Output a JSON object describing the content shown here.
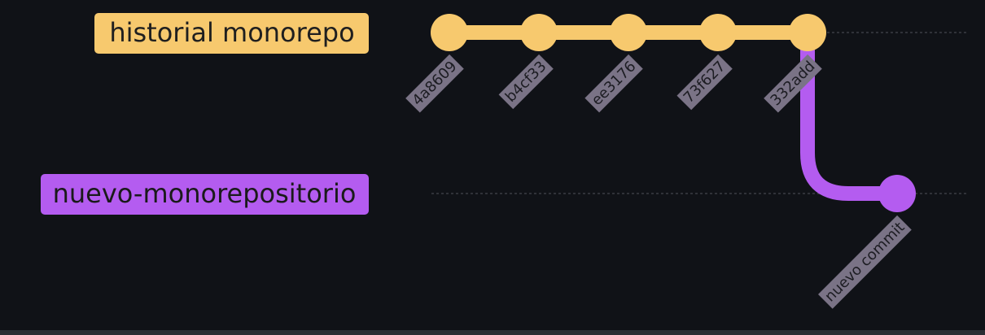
{
  "diagram": {
    "branches": [
      {
        "id": "main",
        "label": "historial monorepo",
        "color": "#f7c96e",
        "label_text_color": "#1f1f1f"
      },
      {
        "id": "new",
        "label": "nuevo-monorepositorio",
        "color": "#b45cf0",
        "label_text_color": "#1a1a1a"
      }
    ],
    "commits": [
      {
        "id": "4a8609",
        "branch": "main"
      },
      {
        "id": "b4cf33",
        "branch": "main"
      },
      {
        "id": "ee3176",
        "branch": "main"
      },
      {
        "id": "73f627",
        "branch": "main"
      },
      {
        "id": "332add",
        "branch": "main"
      },
      {
        "id": "nuevo commit",
        "branch": "new",
        "parent": "332add"
      }
    ],
    "colors": {
      "background": "#101217",
      "commit_label_bg": "#7a7386",
      "commit_label_text": "#1c1c22",
      "guide_line": "#3a3d44"
    }
  }
}
